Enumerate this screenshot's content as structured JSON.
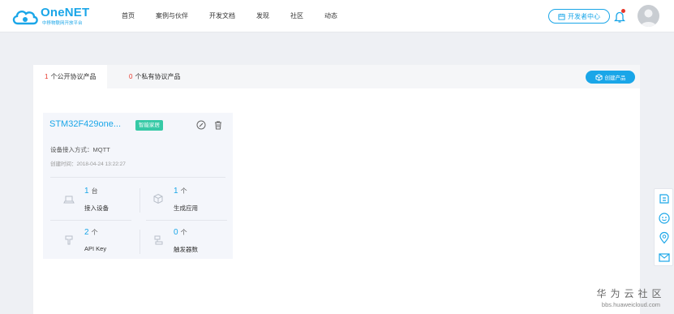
{
  "header": {
    "brand": "OneNET",
    "brand_sub": "中移物联网开放平台",
    "nav": [
      "首页",
      "案例与伙伴",
      "开发文档",
      "发现",
      "社区",
      "动态"
    ],
    "dev_center": "开发者中心",
    "accent": "#1aa6e8",
    "notification_dot_color": "#e8362a"
  },
  "tabs": {
    "public": {
      "count": "1",
      "label": "个公开协议产品"
    },
    "private": {
      "count": "0",
      "label": "个私有协议产品"
    },
    "create_button": "创建产品"
  },
  "card": {
    "title": "STM32F429one...",
    "tag": "智能家居",
    "access_method": "设备接入方式：MQTT",
    "created": "创建时间：2018-04-24 13:22:27",
    "stats": [
      {
        "value": "1",
        "unit": "台",
        "label": "接入设备",
        "icon": "device-icon"
      },
      {
        "value": "1",
        "unit": "个",
        "label": "生成应用",
        "icon": "cube-icon"
      },
      {
        "value": "2",
        "unit": "个",
        "label": "API Key",
        "icon": "key-icon"
      },
      {
        "value": "0",
        "unit": "个",
        "label": "触发器数",
        "icon": "trigger-icon"
      }
    ]
  },
  "watermark": {
    "line1": "华为云社区",
    "line2": "bbs.huaweicloud.com"
  }
}
